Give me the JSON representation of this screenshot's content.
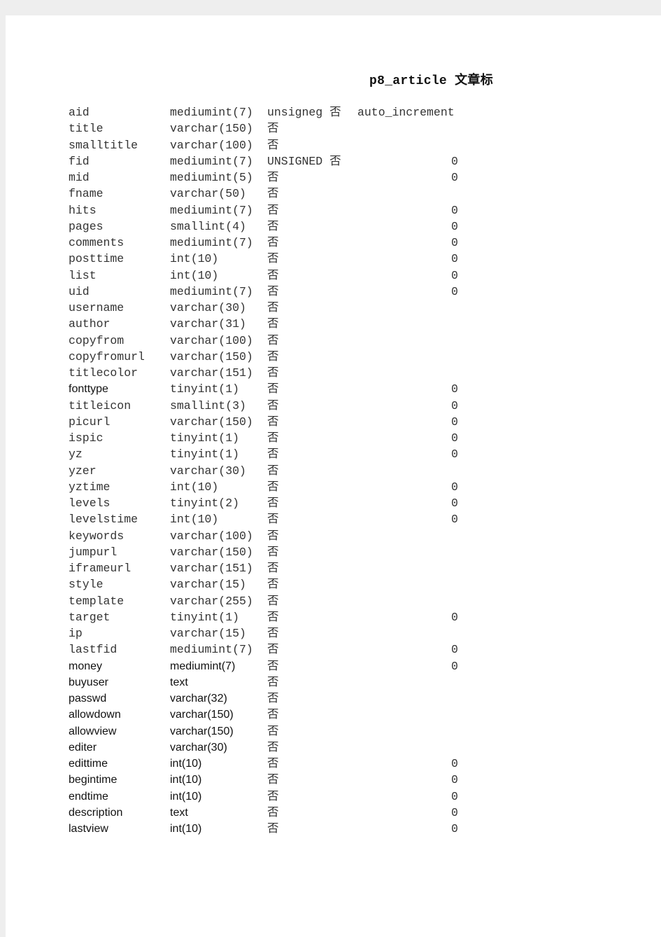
{
  "title": "p8_article 文章标",
  "rows": [
    [
      "aid",
      "mediumint(7)",
      "unsigneg 否",
      "auto_increment",
      ""
    ],
    [
      "title",
      "varchar(150)",
      "否",
      "",
      ""
    ],
    [
      "smalltitle",
      "varchar(100)",
      "否",
      "",
      ""
    ],
    [
      "fid",
      "mediumint(7)",
      "UNSIGNED 否",
      "",
      "0"
    ],
    [
      "mid",
      "mediumint(5)",
      "否",
      "",
      "0"
    ],
    [
      "fname",
      "varchar(50)",
      "否",
      "",
      ""
    ],
    [
      "hits",
      "mediumint(7)",
      "否",
      "",
      "0"
    ],
    [
      "pages",
      "smallint(4)",
      "否",
      "",
      "0"
    ],
    [
      "comments",
      "mediumint(7)",
      "否",
      "",
      "0"
    ],
    [
      "posttime",
      "int(10)",
      "否",
      "",
      "0"
    ],
    [
      "list",
      "int(10)",
      "否",
      "",
      "0"
    ],
    [
      "uid",
      "mediumint(7)",
      "否",
      "",
      "0"
    ],
    [
      "username",
      "varchar(30)",
      "否",
      "",
      ""
    ],
    [
      "author",
      "varchar(31)",
      "否",
      "",
      ""
    ],
    [
      "copyfrom",
      "varchar(100)",
      "否",
      "",
      ""
    ],
    [
      "copyfromurl",
      "varchar(150)",
      "否",
      "",
      ""
    ],
    [
      "titlecolor",
      "varchar(151)",
      "否",
      "",
      ""
    ],
    [
      "fonttype",
      "tinyint(1)",
      "否",
      "",
      "0"
    ],
    [
      "titleicon",
      "smallint(3)",
      "否",
      "",
      "0"
    ],
    [
      "picurl",
      "varchar(150)",
      "否",
      "",
      "0"
    ],
    [
      "ispic",
      "tinyint(1)",
      "否",
      "",
      "0"
    ],
    [
      "yz",
      "tinyint(1)",
      "否",
      "",
      "0"
    ],
    [
      "yzer",
      "varchar(30)",
      "否",
      "",
      ""
    ],
    [
      "yztime",
      "int(10)",
      "否",
      "",
      "0"
    ],
    [
      "levels",
      "tinyint(2)",
      "否",
      "",
      "0"
    ],
    [
      "levelstime",
      "int(10)",
      "否",
      "",
      "0"
    ],
    [
      "keywords",
      "varchar(100)",
      "否",
      "",
      ""
    ],
    [
      "jumpurl",
      "varchar(150)",
      "否",
      "",
      ""
    ],
    [
      "iframeurl",
      "varchar(151)",
      "否",
      "",
      ""
    ],
    [
      "style",
      "varchar(15)",
      "否",
      "",
      ""
    ],
    [
      "template",
      "varchar(255)",
      "否",
      "",
      ""
    ],
    [
      "target",
      "tinyint(1)",
      "否",
      "",
      "0"
    ],
    [
      "ip",
      "varchar(15)",
      "否",
      "",
      ""
    ],
    [
      "lastfid",
      "mediumint(7)",
      "否",
      "",
      "0"
    ],
    [
      "money",
      "mediumint(7)",
      "否",
      "",
      "0"
    ],
    [
      "buyuser",
      "text",
      "否",
      "",
      ""
    ],
    [
      "passwd",
      "varchar(32)",
      "否",
      "",
      ""
    ],
    [
      "allowdown",
      "varchar(150)",
      "否",
      "",
      ""
    ],
    [
      "allowview",
      "varchar(150)",
      "否",
      "",
      ""
    ],
    [
      "editer",
      "varchar(30)",
      "否",
      "",
      ""
    ],
    [
      "edittime",
      "int(10)",
      "否",
      "",
      "0"
    ],
    [
      "begintime",
      "int(10)",
      "否",
      "",
      "0"
    ],
    [
      "endtime",
      "int(10)",
      "否",
      "",
      "0"
    ],
    [
      "description",
      "text",
      "否",
      "",
      "0"
    ],
    [
      "lastview",
      "int(10)",
      "否",
      "",
      "0"
    ]
  ]
}
